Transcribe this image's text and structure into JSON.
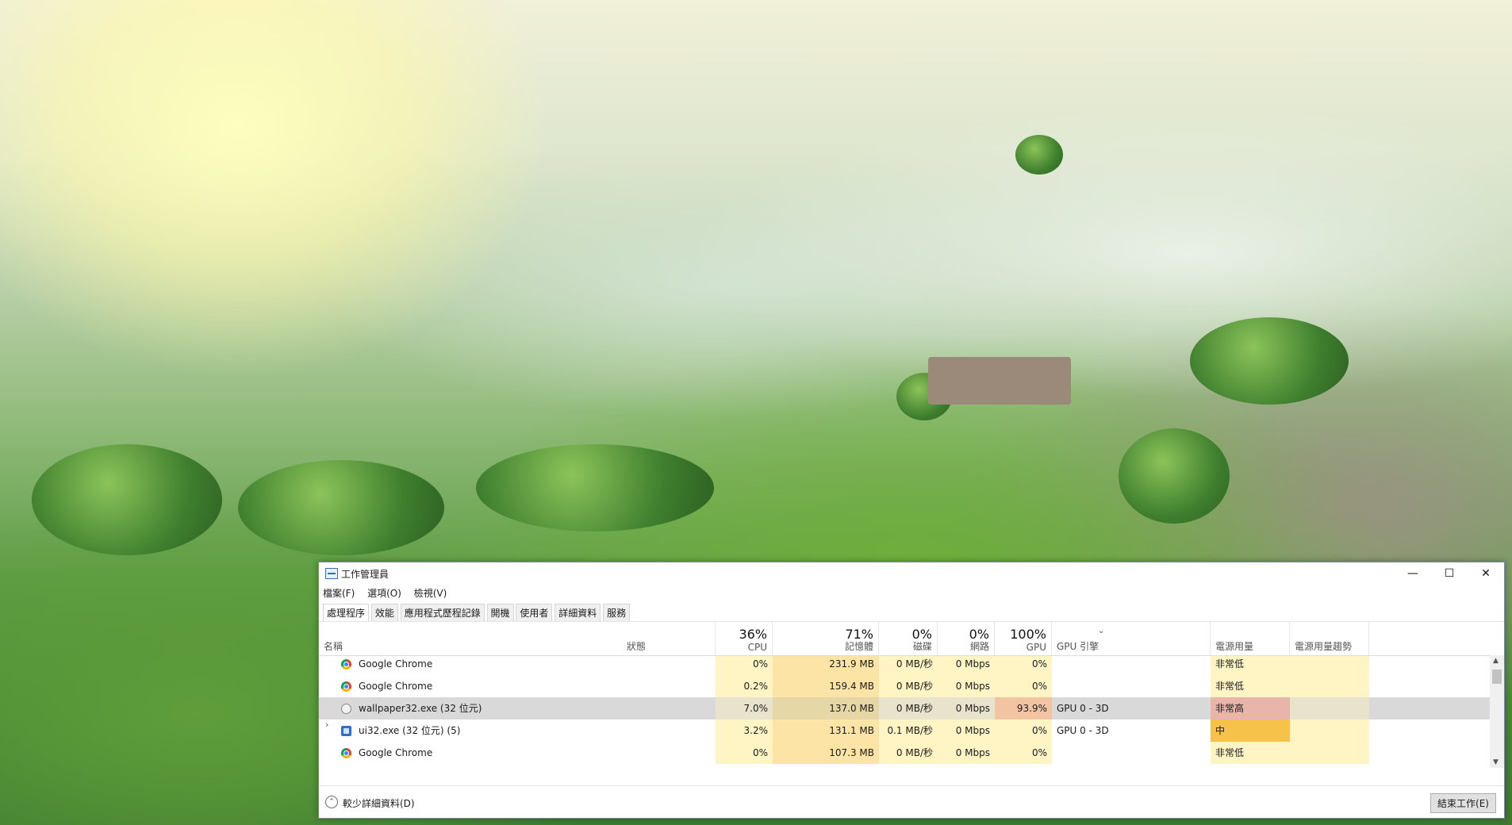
{
  "window": {
    "title": "工作管理員",
    "minimize": "—",
    "maximize": "☐",
    "close": "✕"
  },
  "menu": [
    "檔案(F)",
    "選項(O)",
    "檢視(V)"
  ],
  "tabs": [
    "處理程序",
    "效能",
    "應用程式歷程記錄",
    "開機",
    "使用者",
    "詳細資料",
    "服務"
  ],
  "header": {
    "name": "名稱",
    "status": "狀態",
    "cpu_pct": "36%",
    "cpu": "CPU",
    "mem_pct": "71%",
    "mem": "記憶體",
    "disk_pct": "0%",
    "disk": "磁碟",
    "net_pct": "0%",
    "net": "網路",
    "gpu_pct": "100%",
    "gpu": "GPU",
    "gpu_engine": "GPU 引擎",
    "power": "電源用量",
    "power_trend": "電源用量趨勢",
    "sort_arrow": "⌄"
  },
  "rows": [
    {
      "icon": "chrome-icon",
      "name": "Google Chrome",
      "cpu": "0%",
      "mem": "231.9 MB",
      "disk": "0 MB/秒",
      "net": "0 Mbps",
      "gpu": "0%",
      "engine": "",
      "power": "非常低"
    },
    {
      "icon": "chrome-icon",
      "name": "Google Chrome",
      "cpu": "0.2%",
      "mem": "159.4 MB",
      "disk": "0 MB/秒",
      "net": "0 Mbps",
      "gpu": "0%",
      "engine": "",
      "power": "非常低"
    },
    {
      "icon": "wallpaper-icon",
      "name": "wallpaper32.exe (32 位元)",
      "cpu": "7.0%",
      "mem": "137.0 MB",
      "disk": "0 MB/秒",
      "net": "0 Mbps",
      "gpu": "93.9%",
      "engine": "GPU 0 - 3D",
      "power": "非常高"
    },
    {
      "icon": "ui-icon",
      "name": "ui32.exe (32 位元) (5)",
      "cpu": "3.2%",
      "mem": "131.1 MB",
      "disk": "0.1 MB/秒",
      "net": "0 Mbps",
      "gpu": "0%",
      "engine": "GPU 0 - 3D",
      "power": "中"
    },
    {
      "icon": "chrome-icon",
      "name": "Google Chrome",
      "cpu": "0%",
      "mem": "107.3 MB",
      "disk": "0 MB/秒",
      "net": "0 Mbps",
      "gpu": "0%",
      "engine": "",
      "power": "非常低"
    }
  ],
  "expand_chevron": "›",
  "scroll": {
    "up": "▲",
    "down": "▼"
  },
  "footer": {
    "fewer_details_icon": "⌃",
    "fewer_details": "較少詳細資料(D)",
    "end_task": "結束工作(E)"
  }
}
